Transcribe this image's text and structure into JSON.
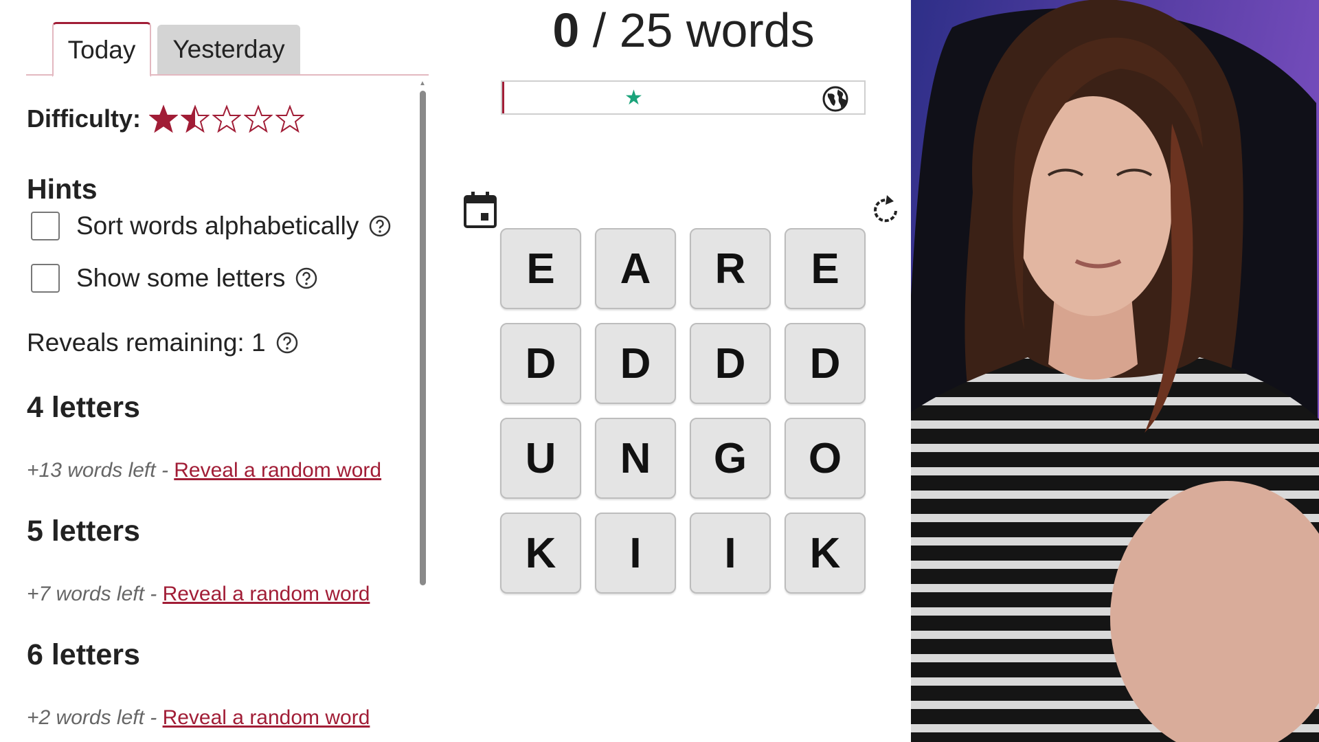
{
  "tabs": {
    "today": "Today",
    "yesterday": "Yesterday"
  },
  "difficulty": {
    "label": "Difficulty:",
    "rating": 1.5,
    "max": 5,
    "color": "#a11d36"
  },
  "hints": {
    "heading": "Hints",
    "sort_label": "Sort words alphabetically",
    "show_letters_label": "Show some letters"
  },
  "reveals": {
    "text": "Reveals remaining: 1"
  },
  "groups": [
    {
      "heading": "4 letters",
      "left": "+13 words left - ",
      "link": "Reveal a random word"
    },
    {
      "heading": "5 letters",
      "left": "+7 words left - ",
      "link": "Reveal a random word"
    },
    {
      "heading": "6 letters",
      "left": "+2 words left - ",
      "link": "Reveal a random word"
    }
  ],
  "score": {
    "found": "0",
    "separator": " / ",
    "total": "25 words"
  },
  "progress": {
    "fraction": 0.0
  },
  "icons": {
    "calendar": "calendar-icon",
    "refresh": "refresh-icon",
    "globe": "globe-icon",
    "help": "help-icon",
    "star": "star-icon"
  },
  "grid": {
    "rows": [
      [
        "E",
        "A",
        "R",
        "E"
      ],
      [
        "D",
        "D",
        "D",
        "D"
      ],
      [
        "U",
        "N",
        "G",
        "O"
      ],
      [
        "K",
        "I",
        "I",
        "K"
      ]
    ]
  },
  "colors": {
    "accent": "#a11d36",
    "progress_star": "#1aa37a",
    "tile_bg": "#e4e4e4"
  }
}
